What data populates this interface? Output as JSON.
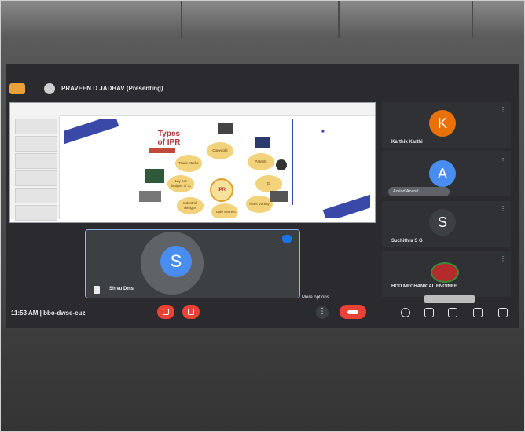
{
  "header": {
    "presenter_label": "PRAVEEN D JADHAV (Presenting)"
  },
  "slide": {
    "title_line1": "Types",
    "title_line2": "of IPR",
    "center": "IPR",
    "nodes": [
      "Copyright",
      "Patents",
      "Trade Marks",
      "GI",
      "Lay out designs of IC",
      "Plant Variety",
      "Industrial designs",
      "Trade secrets"
    ]
  },
  "self_tile": {
    "avatar_letter": "S",
    "name": "Shivu Dms"
  },
  "participants": [
    {
      "letter": "K",
      "name": "Karthik Karthi",
      "color": "#e8710a"
    },
    {
      "letter": "A",
      "name": "Arvind Arvind",
      "color": "#4a8df0"
    },
    {
      "letter": "S",
      "name": "Suchithra S G",
      "color": "#3c4043"
    },
    {
      "letter": "",
      "name": "HOD MECHANICAL ENGINEE...",
      "color": "#b32b2b"
    }
  ],
  "bottom_bar": {
    "time": "11:53 AM",
    "separator": "|",
    "meeting_code": "bbo-dwse-euz",
    "tooltip": "More options"
  }
}
